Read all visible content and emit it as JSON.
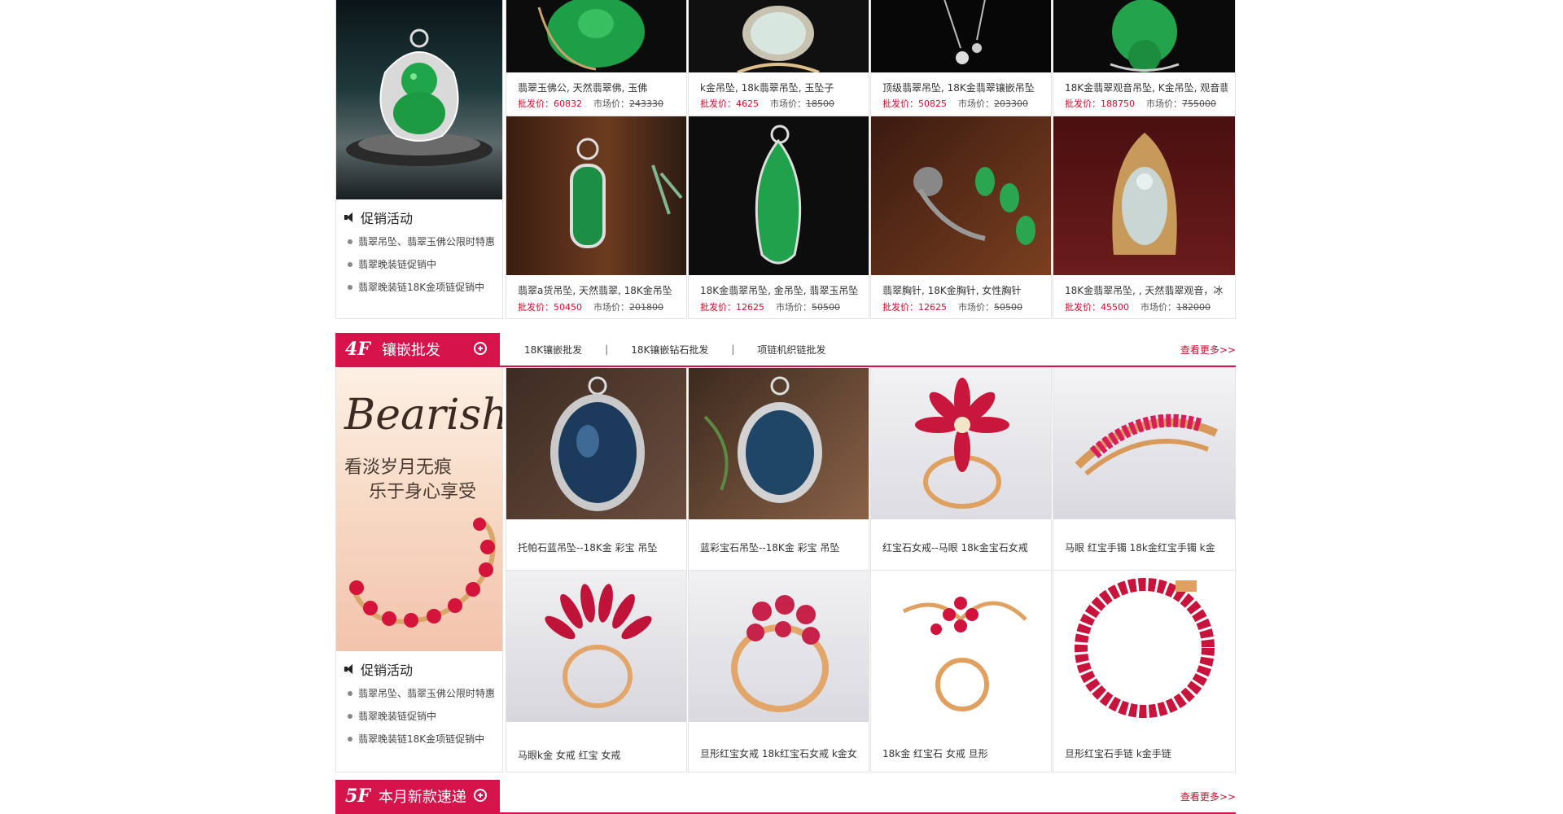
{
  "colors": {
    "accent": "#d4144a",
    "price": "#d0102e"
  },
  "floor3": {
    "promo": {
      "title": "促销活动",
      "items": [
        "翡翠吊坠、翡翠玉佛公限时特惠",
        "翡翠晚装链促销中",
        "翡翠晚装链18K金项链促销中"
      ]
    },
    "products": [
      {
        "name": "翡翠玉佛公, 天然翡翠佛, 玉佛",
        "wholesale_label": "批发价：",
        "wholesale": "60832",
        "market_label": "市场价：",
        "market": "243330"
      },
      {
        "name": "k金吊坠, 18k翡翠吊坠, 玉坠子",
        "wholesale_label": "批发价：",
        "wholesale": "4625",
        "market_label": "市场价：",
        "market": "18500"
      },
      {
        "name": "顶级翡翠吊坠, 18K金翡翠镶嵌吊坠",
        "wholesale_label": "批发价：",
        "wholesale": "50825",
        "market_label": "市场价：",
        "market": "203300"
      },
      {
        "name": "18K金翡翠观音吊坠, K金吊坠, 观音翡",
        "wholesale_label": "批发价：",
        "wholesale": "188750",
        "market_label": "市场价：",
        "market": "755000"
      },
      {
        "name": "翡翠a货吊坠, 天然翡翠, 18K金吊坠",
        "wholesale_label": "批发价：",
        "wholesale": "50450",
        "market_label": "市场价：",
        "market": "201800"
      },
      {
        "name": "18K金翡翠吊坠, 金吊坠, 翡翠玉吊坠",
        "wholesale_label": "批发价：",
        "wholesale": "12625",
        "market_label": "市场价：",
        "market": "50500"
      },
      {
        "name": "翡翠胸针, 18K金胸针, 女性胸针",
        "wholesale_label": "批发价：",
        "wholesale": "12625",
        "market_label": "市场价：",
        "market": "50500"
      },
      {
        "name": "18K金翡翠吊坠, , 天然翡翠观音，冰",
        "wholesale_label": "批发价：",
        "wholesale": "45500",
        "market_label": "市场价：",
        "market": "182000"
      }
    ]
  },
  "floor4": {
    "num": "4F",
    "title": "镶嵌批发",
    "tabs": [
      "18K镶嵌批发",
      "18K镶嵌钻石批发",
      "项链机织链批发"
    ],
    "more": "查看更多>>",
    "banner": {
      "script": "Bearish",
      "line1": "看淡岁月无痕",
      "line2": "乐于身心享受"
    },
    "promo": {
      "title": "促销活动",
      "items": [
        "翡翠吊坠、翡翠玉佛公限时特惠",
        "翡翠晚装链促销中",
        "翡翠晚装链18K金项链促销中"
      ]
    },
    "products": [
      {
        "name": "托帕石蓝吊坠--18K金 彩宝 吊坠"
      },
      {
        "name": "蓝彩宝石吊坠--18K金 彩宝 吊坠"
      },
      {
        "name": "红宝石女戒--马眼 18k金宝石女戒"
      },
      {
        "name": "马眼 红宝手镯 18k金红宝手镯 k金"
      },
      {
        "name": "马眼k金 女戒 红宝 女戒"
      },
      {
        "name": "旦形红宝女戒 18k红宝石女戒 k金女"
      },
      {
        "name": "18k金 红宝石 女戒 旦形"
      },
      {
        "name": "旦形红宝石手链 k金手链"
      }
    ]
  },
  "floor5": {
    "num": "5F",
    "title": "本月新款速递",
    "more": "查看更多>>"
  }
}
